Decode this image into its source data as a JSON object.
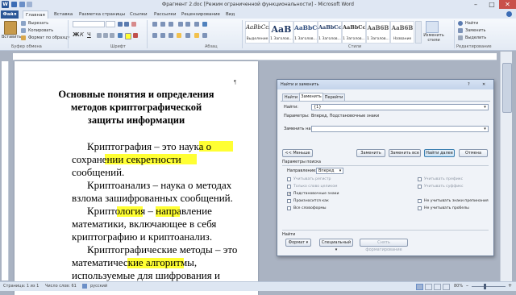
{
  "window": {
    "title": "Фрагмент 2.doc [Режим ограниченной функциональности] - Microsoft Word"
  },
  "tabs": [
    "Файл",
    "Главная",
    "Вставка",
    "Разметка страницы",
    "Ссылки",
    "Рассылки",
    "Рецензирование",
    "Вид"
  ],
  "ribbon": {
    "clipboard": {
      "paste": "Вставить",
      "cut": "Вырезать",
      "copy": "Копировать",
      "format_painter": "Формат по образцу",
      "label": "Буфер обмена"
    },
    "font": {
      "label": "Шрифт"
    },
    "paragraph": {
      "label": "Абзац"
    },
    "styles": {
      "label": "Стили",
      "items": [
        {
          "sample": "AaBbCcI",
          "name": "Выделение"
        },
        {
          "sample": "AaB",
          "name": "1 Заголов..."
        },
        {
          "sample": "AaBbCc",
          "name": "1 Заголов..."
        },
        {
          "sample": "AaBbCcI",
          "name": "1 Заголов..."
        },
        {
          "sample": "AaBbCcI",
          "name": "1 Заголов..."
        },
        {
          "sample": "AaB6B",
          "name": "1 Заголов..."
        },
        {
          "sample": "AaB6B",
          "name": "Название"
        }
      ],
      "change_styles": "Изменить стили"
    },
    "editing": {
      "find": "Найти",
      "replace": "Заменить",
      "select": "Выделить",
      "label": "Редактирование"
    }
  },
  "document": {
    "title_lines": [
      "Основные понятия и определения",
      "методов криптографической",
      "защиты информации"
    ],
    "body_lines": [
      "Криптография – это наука        о",
      "сохранении                      секретности",
      "сообщений.",
      "Криптоанализ – наука о методах",
      "взлома зашифрованных сообщений.",
      "Криптология      –      направление",
      "математики,    включающее    в    себя",
      "криптографию и криптоанализ.",
      "Криптографические методы – это",
      "математические              алгоритмы,",
      "используемые    для    шифрования    и"
    ],
    "paragraph_mark": "¶"
  },
  "dialog": {
    "title": "Найти и заменить",
    "help": "?",
    "close": "✕",
    "tabs": [
      "Найти",
      "Заменить",
      "Перейти"
    ],
    "find_label": "Найти:",
    "find_value": "{1}",
    "params_label": "Параметры:",
    "params_value": "Вперед, Подстановочные знаки",
    "replace_label": "Заменить на:",
    "replace_value": "",
    "buttons": {
      "less": "<< Меньше",
      "replace": "Заменить",
      "replace_all": "Заменить все",
      "find_next": "Найти далее",
      "cancel": "Отмена"
    },
    "search_options_label": "Параметры поиска",
    "direction_label": "Направление:",
    "direction_value": "Вперед",
    "options_left": [
      {
        "label": "Учитывать регистр",
        "checked": false,
        "enabled": false
      },
      {
        "label": "Только слово целиком",
        "checked": false,
        "enabled": false
      },
      {
        "label": "Подстановочные знаки",
        "checked": true,
        "enabled": true
      },
      {
        "label": "Произносится как",
        "checked": false,
        "enabled": true
      },
      {
        "label": "Все словоформы",
        "checked": false,
        "enabled": true
      }
    ],
    "options_right": [
      {
        "label": "Учитывать префикс",
        "checked": false,
        "enabled": false
      },
      {
        "label": "Учитывать суффикс",
        "checked": false,
        "enabled": false
      },
      {
        "label": "Не учитывать знаки препинания",
        "checked": false,
        "enabled": true
      },
      {
        "label": "Не учитывать пробелы",
        "checked": false,
        "enabled": true
      }
    ],
    "replace_section_label": "Найти",
    "format_btn": "Формат ▾",
    "special_btn": "Специальный ▾",
    "no_format_btn": "Снять форматирование"
  },
  "statusbar": {
    "page": "Страница: 1 из 1",
    "words": "Число слов: 61",
    "language": "русский",
    "zoom": "80%"
  },
  "colors": {
    "highlight": "#ffff33",
    "file_tab": "#2b5797",
    "accent": "#3c7fb1"
  }
}
